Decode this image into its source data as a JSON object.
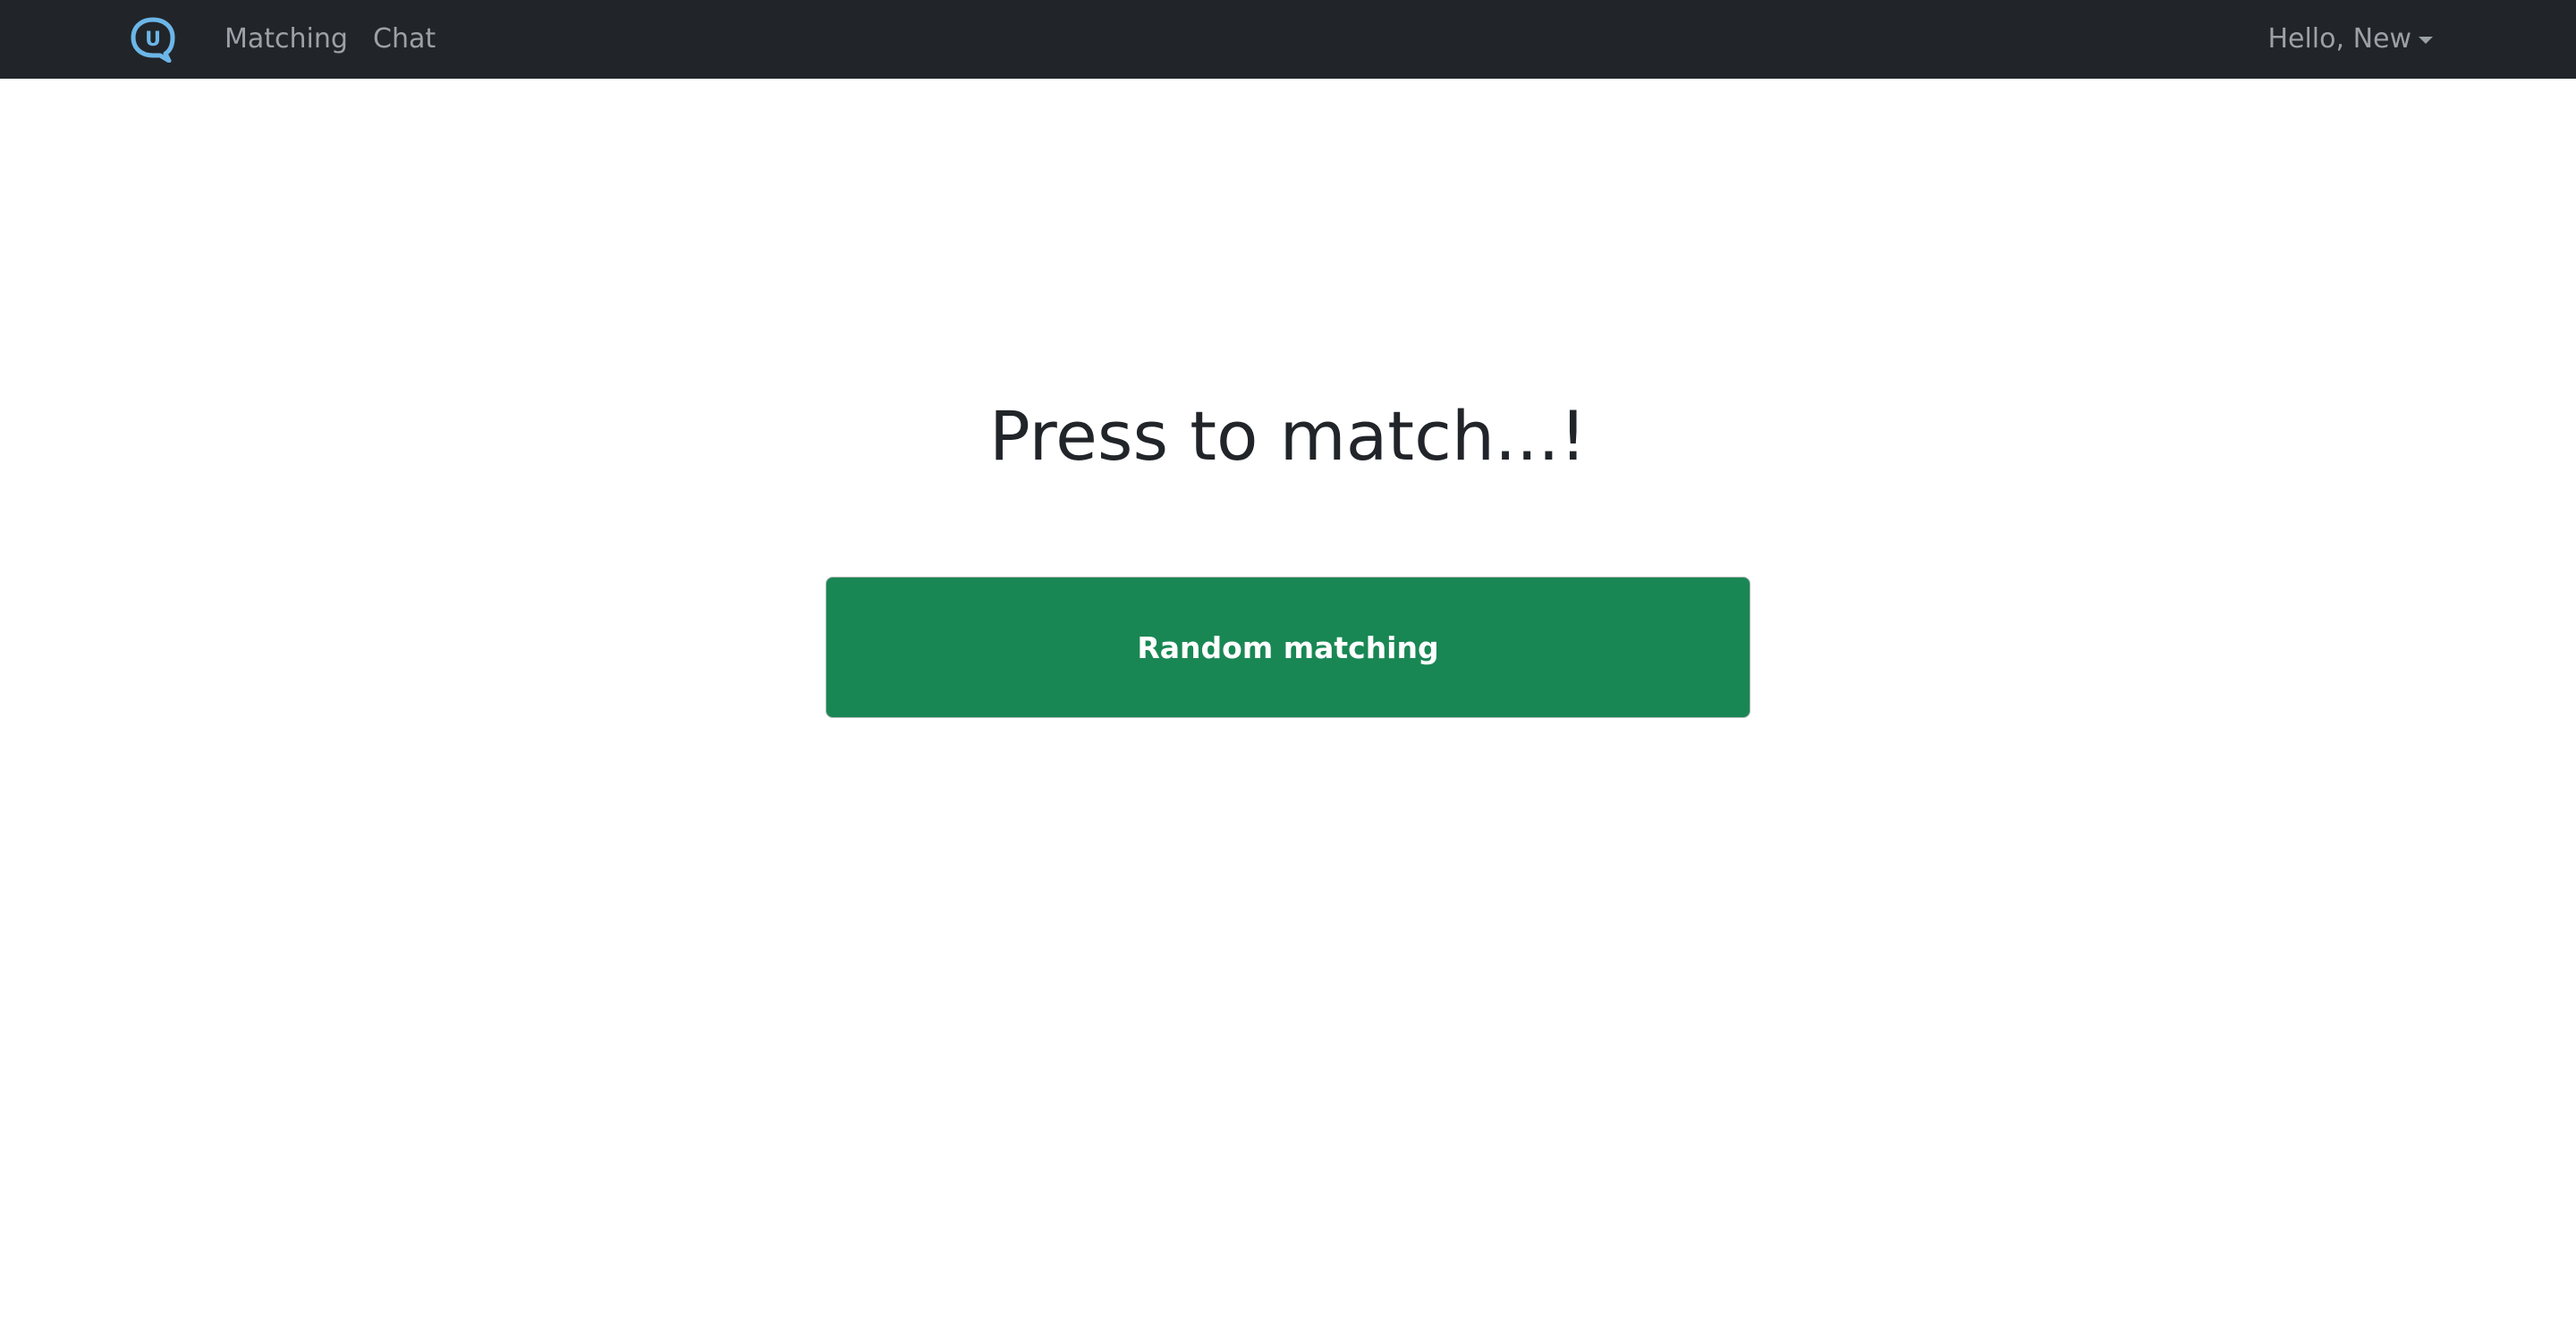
{
  "navbar": {
    "logo_letter": "U",
    "links": [
      {
        "label": "Matching"
      },
      {
        "label": "Chat"
      }
    ],
    "user_menu_label": "Hello, New"
  },
  "main": {
    "heading": "Press to match...!",
    "button_label": "Random matching"
  },
  "colors": {
    "navbar_bg": "#212529",
    "logo": "#6cb6e8",
    "button_bg": "#198754"
  }
}
